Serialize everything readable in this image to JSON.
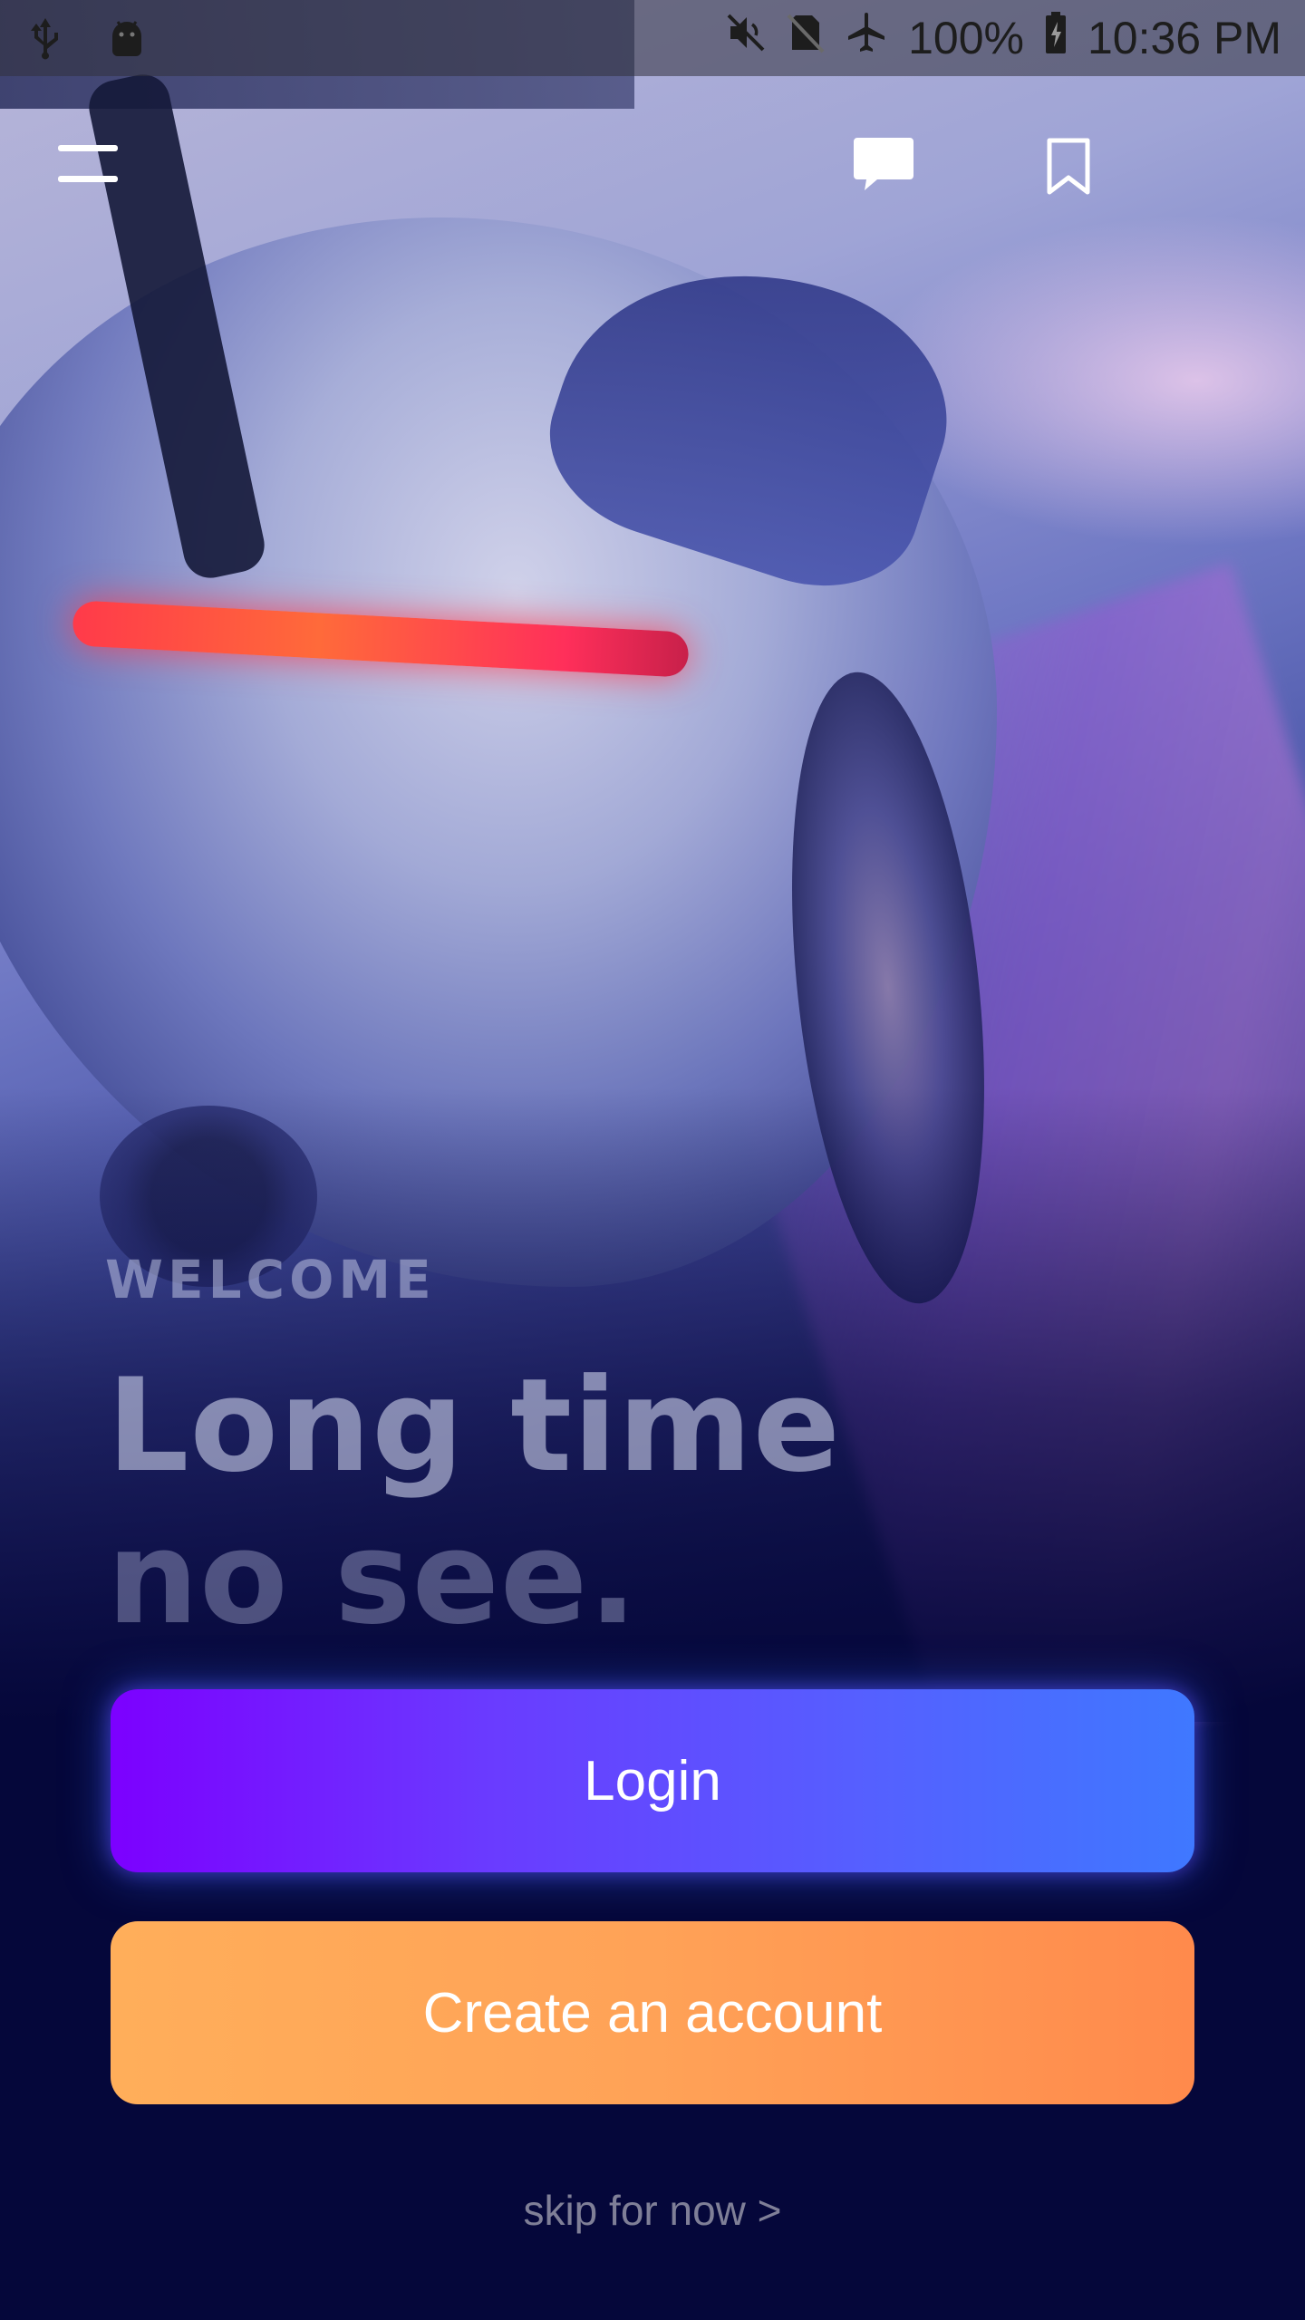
{
  "status_bar": {
    "left_icons": [
      "usb-icon",
      "android-debug-icon"
    ],
    "right_icons": [
      "mute-icon",
      "no-sim-icon",
      "airplane-mode-icon",
      "battery-charging-icon"
    ],
    "battery": "100%",
    "time": "10:36 PM"
  },
  "app_bar": {
    "menu_icon": "hamburger-menu-icon",
    "chat_icon": "chat-bubble-icon",
    "bookmark_icon": "bookmark-icon"
  },
  "welcome": {
    "eyebrow": "WELCOME",
    "headline_line1": "Long time",
    "headline_line2": "no see."
  },
  "actions": {
    "login_label": "Login",
    "create_account_label": "Create an account",
    "skip_label": "skip for now >"
  },
  "colors": {
    "background": "#05073a",
    "login_gradient": [
      "#7c00ff",
      "#3f78ff"
    ],
    "create_gradient": [
      "#ffae5a",
      "#ff8a4c"
    ]
  }
}
